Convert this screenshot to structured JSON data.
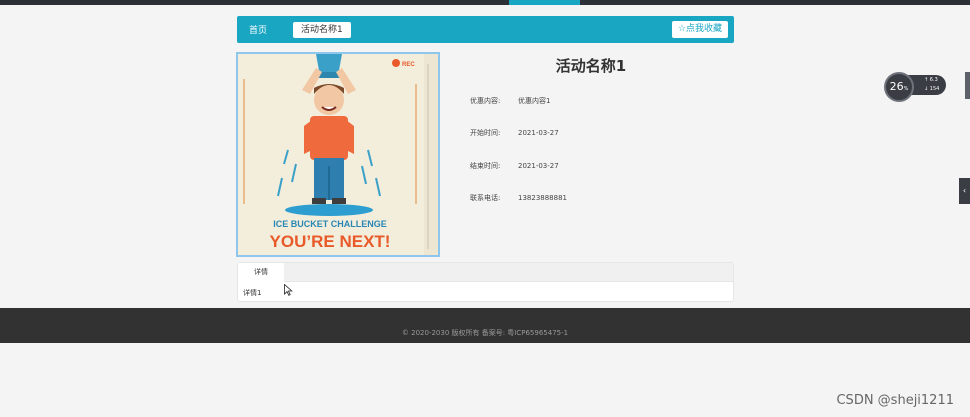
{
  "breadcrumb": {
    "home": "首页",
    "current": "活动名称1",
    "favorite_label": "☆点我收藏"
  },
  "poster": {
    "rec_label": "REC",
    "line1": "ICE BUCKET CHALLENGE",
    "line2": "YOU’RE NEXT!"
  },
  "detail": {
    "title": "活动名称1",
    "fields": [
      {
        "label": "优惠内容:",
        "value": "优惠内容1"
      },
      {
        "label": "开始时间:",
        "value": "2021-03-27"
      },
      {
        "label": "结束时间:",
        "value": "2021-03-27"
      },
      {
        "label": "联系电话:",
        "value": "13823888881"
      }
    ]
  },
  "tabs": {
    "active": "详情",
    "content": "详情1"
  },
  "footer": {
    "text": "© 2020-2030 版权所有  备案号:  粤ICP65965475-1"
  },
  "speed_widget": {
    "percent": "26",
    "unit": "%",
    "up": "6.3",
    "down": "154"
  },
  "watermark": "CSDN @sheji1211",
  "colors": {
    "accent": "#19a6c2",
    "footer_bg": "#323232",
    "top_bar": "#2c2f36"
  }
}
